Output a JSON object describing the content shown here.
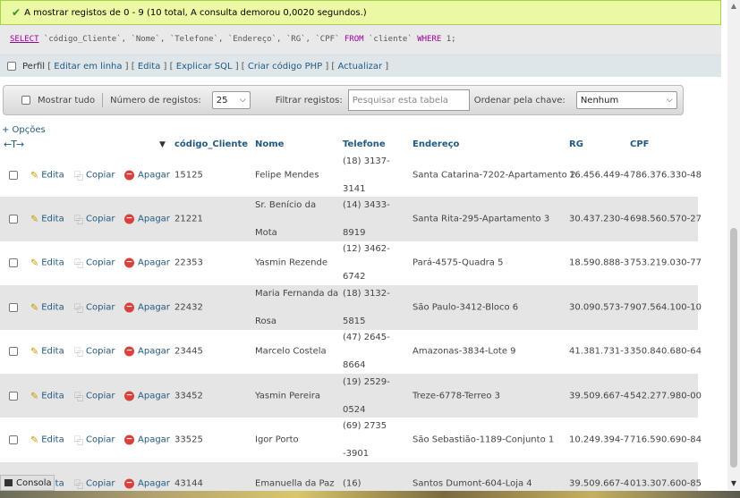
{
  "message": "A mostrar registos de 0 - 9 (10 total, A consulta demorou 0,0020 segundos.)",
  "sql": {
    "select": "SELECT",
    "columns": " `código_Cliente`, `Nome`, `Telefone`, `Endereço`, `RG`, `CPF` ",
    "from": "FROM",
    "table": " `cliente` ",
    "where": "WHERE",
    "cond": " 1;"
  },
  "query_links": {
    "profiling": "Perfil",
    "edit_inline": "Editar em linha",
    "edit": "Edita",
    "explain": "Explicar SQL",
    "php": "Criar código PHP",
    "refresh": "Actualizar"
  },
  "navbar": {
    "show_all": "Mostrar tudo",
    "num_rows_label": "Número de registos:",
    "num_rows_value": "25",
    "filter_label": "Filtrar registos:",
    "filter_placeholder": "Pesquisar esta tabela",
    "sort_label": "Ordenar pela chave:",
    "sort_value": "Nenhum"
  },
  "options_link": "+ Opções",
  "table": {
    "arrows": "←T→",
    "sort_marker": "▼",
    "columns": [
      "código_Cliente",
      "Nome",
      "Telefone",
      "Endereço",
      "RG",
      "CPF"
    ],
    "actions": {
      "edit": "Edita",
      "copy": "Copiar",
      "delete": "Apagar"
    },
    "rows": [
      {
        "id": "15125",
        "nome": "Felipe Mendes",
        "telefone": "(18) 3137-3141",
        "endereco": "Santa Catarina-7202-Apartamento 2",
        "rg": "16.456.449-4",
        "cpf": "786.376.330-48"
      },
      {
        "id": "21221",
        "nome": "Sr. Benício da Mota",
        "telefone": "(14) 3433-8919",
        "endereco": "Santa Rita-295-Apartamento 3",
        "rg": "30.437.230-4",
        "cpf": "698.560.570-27"
      },
      {
        "id": "22353",
        "nome": "Yasmin Rezende",
        "telefone": "(12) 3462-6742",
        "endereco": "Pará-4575-Quadra 5",
        "rg": "18.590.888-3",
        "cpf": "753.219.030-77"
      },
      {
        "id": "22432",
        "nome": "Maria Fernanda da Rosa",
        "telefone": "(18) 3132-5815",
        "endereco": "São Paulo-3412-Bloco 6",
        "rg": "30.090.573-7",
        "cpf": "907.564.100-10"
      },
      {
        "id": "23445",
        "nome": "Marcelo Costela",
        "telefone": "(47) 2645-8664",
        "endereco": "Amazonas-3834-Lote 9",
        "rg": "41.381.731-3",
        "cpf": "350.840.680-64"
      },
      {
        "id": "33452",
        "nome": "Yasmin Pereira",
        "telefone": "(19) 2529-0524",
        "endereco": "Treze-6778-Terreo 3",
        "rg": "39.509.667-4",
        "cpf": "542.277.980-00"
      },
      {
        "id": "33525",
        "nome": "Igor Porto",
        "telefone": "(69) 2735 -3901",
        "endereco": "São Sebastião-1189-Conjunto 1",
        "rg": "10.249.394-7",
        "cpf": "716.590.690-84"
      },
      {
        "id": "43144",
        "nome": "Emanuella da Paz",
        "telefone": "(16)",
        "endereco": "Santos Dumont-604-Loja 4",
        "rg": "39.509.667-4",
        "cpf": "013.307.600-85"
      }
    ]
  },
  "console_label": "Consola"
}
